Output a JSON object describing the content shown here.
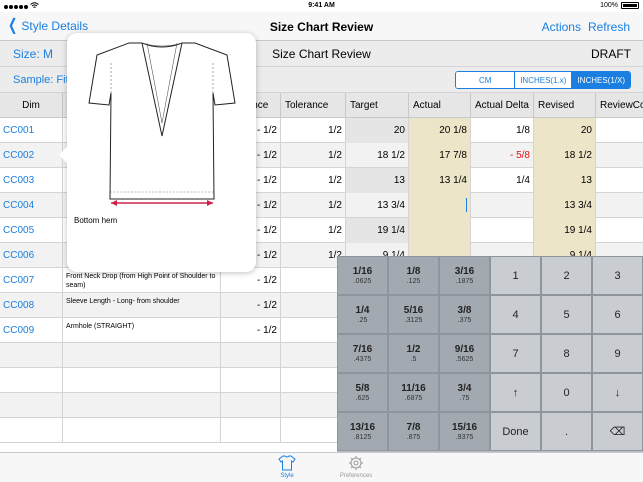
{
  "status_bar": {
    "time": "9:41 AM",
    "battery": "100%"
  },
  "nav": {
    "back_label": "Style Details",
    "title": "Size Chart Review",
    "actions": "Actions",
    "refresh": "Refresh"
  },
  "subheader": {
    "size": "Size: M",
    "title": "Size Chart Review",
    "status": "DRAFT"
  },
  "sample": {
    "label": "Sample: Fit"
  },
  "units": {
    "options": [
      "CM",
      "INCHES(1.x)",
      "INCHES(1/X)"
    ],
    "selected": "INCHES(1/X)"
  },
  "table": {
    "headers": [
      "Dim",
      "D",
      "Tolerance",
      "Tolerance",
      "Target",
      "Actual",
      "Actual Delta",
      "Revised",
      "ReviewComments"
    ],
    "rows": [
      {
        "dim": "CC001",
        "desc": "",
        "tol": "- 1/2",
        "tol2": "1/2",
        "target": "20",
        "actual": "20 1/8",
        "delta": "1/8",
        "revised": "20",
        "delta_red": false
      },
      {
        "dim": "CC002",
        "desc": "",
        "tol": "- 1/2",
        "tol2": "1/2",
        "target": "18 1/2",
        "actual": "17 7/8",
        "delta": "- 5/8",
        "revised": "18 1/2",
        "delta_red": true
      },
      {
        "dim": "CC003",
        "desc": "",
        "tol": "- 1/2",
        "tol2": "1/2",
        "target": "13",
        "actual": "13 1/4",
        "delta": "1/4",
        "revised": "13",
        "delta_red": false
      },
      {
        "dim": "CC004",
        "desc": "",
        "tol": "- 1/2",
        "tol2": "1/2",
        "target": "13 3/4",
        "actual": "",
        "delta": "",
        "revised": "13 3/4",
        "delta_red": false
      },
      {
        "dim": "CC005",
        "desc": "",
        "tol": "- 1/2",
        "tol2": "1/2",
        "target": "19 1/4",
        "actual": "",
        "delta": "",
        "revised": "19 1/4",
        "delta_red": false
      },
      {
        "dim": "CC006",
        "desc": "",
        "tol": "- 1/2",
        "tol2": "1/2",
        "target": "9 1/4",
        "actual": "",
        "delta": "",
        "revised": "9 1/4",
        "delta_red": false
      },
      {
        "dim": "CC007",
        "desc": "Front Neck Drop (from High Point of Shoulder to seam)",
        "tol": "- 1/2",
        "tol2": "",
        "target": "",
        "actual": "",
        "delta": "",
        "revised": "",
        "delta_red": false
      },
      {
        "dim": "CC008",
        "desc": "Sleeve Length - Long- from shoulder",
        "tol": "- 1/2",
        "tol2": "",
        "target": "",
        "actual": "",
        "delta": "",
        "revised": "",
        "delta_red": false
      },
      {
        "dim": "CC009",
        "desc": "Armhole (STRAIGHT)",
        "tol": "- 1/2",
        "tol2": "",
        "target": "",
        "actual": "",
        "delta": "",
        "revised": "",
        "delta_red": false
      }
    ]
  },
  "popover": {
    "caption": "Bottom hem"
  },
  "keypad": {
    "fractions": [
      [
        "1/16",
        ".0625"
      ],
      [
        "1/8",
        ".125"
      ],
      [
        "3/16",
        ".1875"
      ],
      [
        "1/4",
        ".25"
      ],
      [
        "5/16",
        ".3125"
      ],
      [
        "3/8",
        ".375"
      ],
      [
        "7/16",
        ".4375"
      ],
      [
        "1/2",
        ".5"
      ],
      [
        "9/16",
        ".5625"
      ],
      [
        "5/8",
        ".625"
      ],
      [
        "11/16",
        ".6875"
      ],
      [
        "3/4",
        ".75"
      ],
      [
        "13/16",
        ".8125"
      ],
      [
        "7/8",
        ".875"
      ],
      [
        "15/16",
        ".9375"
      ]
    ],
    "numbers": [
      "1",
      "2",
      "3",
      "4",
      "5",
      "6",
      "7",
      "8",
      "9",
      "↑",
      "0",
      "↓",
      "Done",
      ".",
      "⌫"
    ]
  },
  "tabbar": {
    "style": "Style",
    "preferences": "Preferences"
  },
  "colors": {
    "accent": "#1a7fe0",
    "negative": "#e01010",
    "highlight": "#ede5c8"
  }
}
